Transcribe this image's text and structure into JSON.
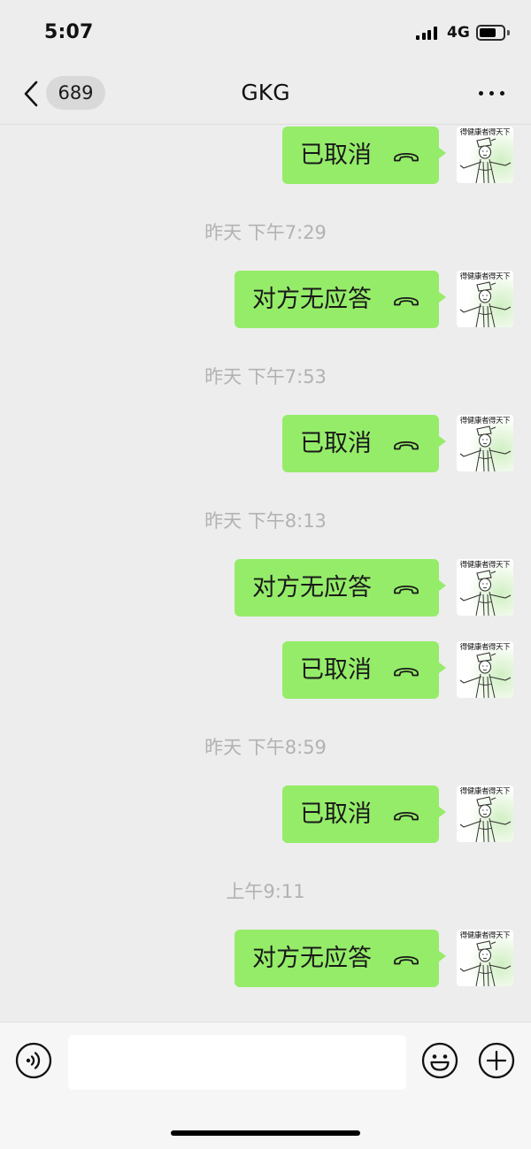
{
  "status_bar": {
    "time": "5:07",
    "network": "4G",
    "signal_bars": 4,
    "battery_level": 0.72
  },
  "nav": {
    "back_icon": "chevron-left-icon",
    "unread_count": "689",
    "title": "GKG",
    "more_icon": "more-icon"
  },
  "avatar": {
    "caption": "得健康者得天下"
  },
  "messages": [
    {
      "type": "call",
      "text": "已取消",
      "icon": "hangup-icon"
    },
    {
      "type": "time",
      "text": "昨天 下午7:29"
    },
    {
      "type": "call",
      "text": "对方无应答",
      "icon": "hangup-icon"
    },
    {
      "type": "time",
      "text": "昨天 下午7:53"
    },
    {
      "type": "call",
      "text": "已取消",
      "icon": "hangup-icon"
    },
    {
      "type": "time",
      "text": "昨天 下午8:13"
    },
    {
      "type": "call",
      "text": "对方无应答",
      "icon": "hangup-icon"
    },
    {
      "type": "call",
      "text": "已取消",
      "icon": "hangup-icon"
    },
    {
      "type": "time",
      "text": "昨天 下午8:59"
    },
    {
      "type": "call",
      "text": "已取消",
      "icon": "hangup-icon"
    },
    {
      "type": "time",
      "text": "上午9:11"
    },
    {
      "type": "call",
      "text": "对方无应答",
      "icon": "hangup-icon"
    }
  ],
  "composer": {
    "input_value": "",
    "voice_icon": "voice-icon",
    "emoji_icon": "emoji-icon",
    "plus_icon": "plus-icon"
  },
  "colors": {
    "background": "#EDEDED",
    "bubble": "#95EC69",
    "timestamp": "#B2B2B2"
  }
}
